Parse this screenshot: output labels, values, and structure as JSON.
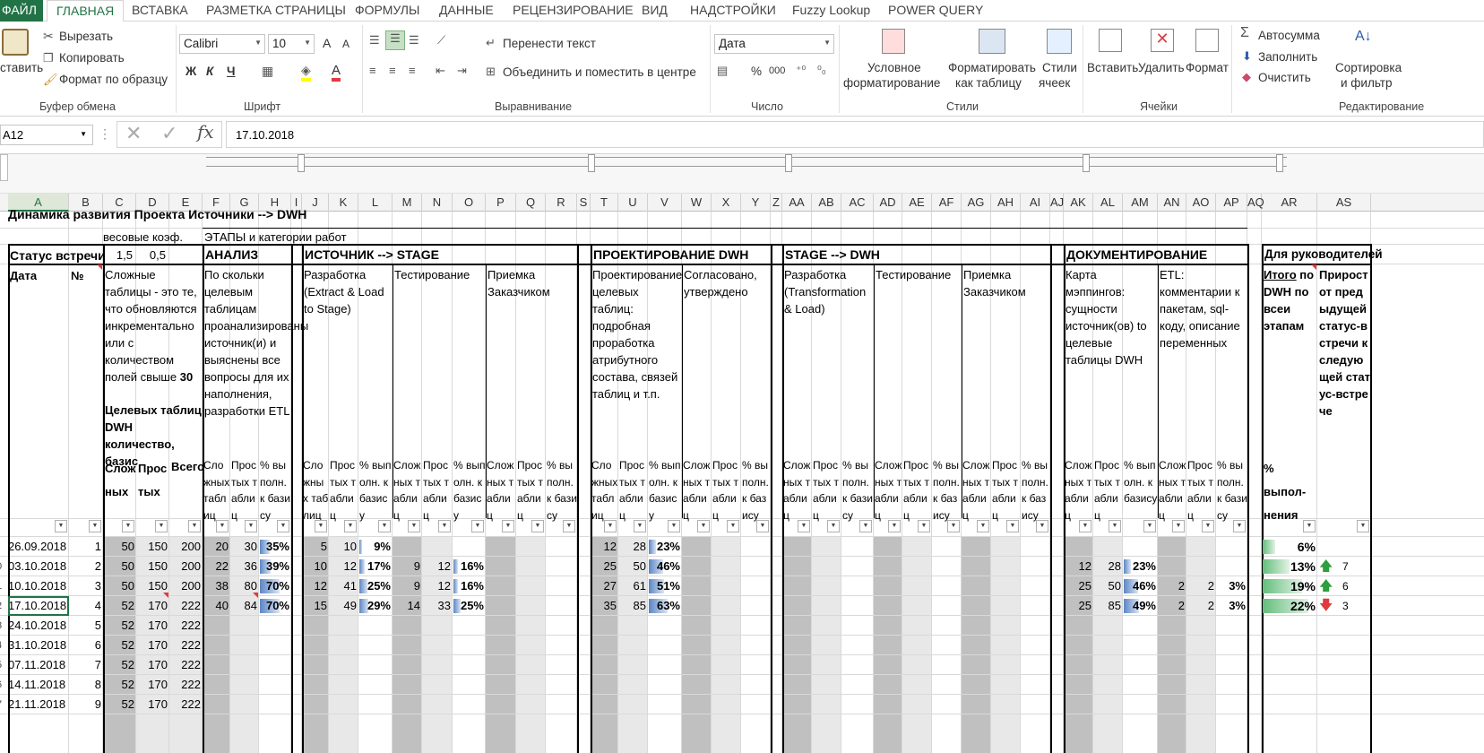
{
  "ribbon_tabs": [
    "ФАЙЛ",
    "ГЛАВНАЯ",
    "ВСТАВКА",
    "РАЗМЕТКА СТРАНИЦЫ",
    "ФОРМУЛЫ",
    "ДАННЫЕ",
    "РЕЦЕНЗИРОВАНИЕ",
    "ВИД",
    "НАДСТРОЙКИ",
    "Fuzzy Lookup",
    "POWER QUERY"
  ],
  "clipboard": {
    "paste": "ставить",
    "cut": "Вырезать",
    "copy": "Копировать",
    "painter": "Формат по образцу",
    "group": "Буфер обмена"
  },
  "font": {
    "name": "Calibri",
    "size": "10",
    "bold": "Ж",
    "italic": "К",
    "underline": "Ч",
    "color_a": "А",
    "group": "Шрифт",
    "grow": "A",
    "shrink": "A"
  },
  "align": {
    "wrap": "Перенести текст",
    "merge": "Объединить и поместить в центре",
    "group": "Выравнивание"
  },
  "number": {
    "format": "Дата",
    "percent": "%",
    "thousands": "000",
    "group": "Число"
  },
  "styles": {
    "cond1": "Условное",
    "cond2": "форматирование",
    "fmt1": "Форматировать",
    "fmt2": "как таблицу",
    "cell1": "Стили",
    "cell2": "ячеек",
    "group": "Стили"
  },
  "cells": {
    "insert": "Вставить",
    "delete": "Удалить",
    "format": "Формат",
    "group": "Ячейки"
  },
  "editing": {
    "autosum": "Автосумма",
    "fill": "Заполнить",
    "clear": "Очистить",
    "sort1": "Сортировка",
    "sort2": "и фильтр",
    "group": "Редактирование"
  },
  "formula_bar": {
    "name_box": "A12",
    "fx": "fx",
    "value": "17.10.2018"
  },
  "columns": [
    "A",
    "B",
    "C",
    "D",
    "E",
    "F",
    "G",
    "H",
    "I",
    "J",
    "K",
    "L",
    "M",
    "N",
    "O",
    "P",
    "Q",
    "R",
    "S",
    "T",
    "U",
    "V",
    "W",
    "X",
    "Y",
    "Z",
    "AA",
    "AB",
    "AC",
    "AD",
    "AE",
    "AF",
    "AG",
    "AH",
    "AI",
    "AJ",
    "AK",
    "AL",
    "AM",
    "AN",
    "AO",
    "AP",
    "AQ",
    "AR",
    "AS"
  ],
  "title": "Динамика развития Проекта Источники --> DWH",
  "weights_label": "весовые коэф.",
  "weight_complex": "1,5",
  "weight_simple": "0,5",
  "stages_label": "ЭТАПЫ и категории работ",
  "status_label": "Статус встречи",
  "sections": {
    "analysis": "АНАЛИЗ",
    "source": "ИСТОЧНИК --> STAGE",
    "design": "ПРОЕКТИРОВАНИЕ DWH",
    "stage_dwh": "STAGE --> DWH",
    "docs": "ДОКУМЕНТИРОВАНИЕ",
    "managers": "Для руководителей"
  },
  "hdr": {
    "date": "Дата",
    "num": "№",
    "complex_desc": "Сложные таблицы - это те, что обновляются инкрементально или с количеством полей свыше",
    "complex_n": "30",
    "target": "Целевых таблиц DWH количество, базис",
    "analysis_desc": "По скольки целевым таблицам проанализированы источник(и) и выяснены все вопросы для их наполнения, разработки ETL",
    "dev_etl": "Разработка (Extract & Load to Stage)",
    "testing": "Тестирование",
    "acceptance": "Приемка Заказчиком",
    "design_desc": "Проектирование целевых таблиц: подробная проработка атрибутного состава, связей таблиц и т.п.",
    "approved": "Согласовано, утверждено",
    "dev_tl": "Разработка (Transformation & Load)",
    "mapping": "Карта мэппингов: сущности источник(ов) to целевые таблицы DWH",
    "etl_comments": "ETL: комментарии к пакетам, sql-коду, описание переменных",
    "total_pre": "Итого",
    "total_rest": "по DWH по всеи этапам",
    "growth": "Прирост от предыдущей статус-встречи к следующей статус-встрече",
    "complex": "Сложных",
    "simple": "Простых",
    "all": "Всего",
    "sub_complex": "Сложных таблиц",
    "sub_simple": "Простых таблиц",
    "sub_pct": "% выполн. к базису",
    "pct_done": "% выпол-нения"
  },
  "rows": [
    {
      "rn": "",
      "date": "26.09.2018",
      "n": "1",
      "c": "50",
      "s": "150",
      "t": "200",
      "an": [
        "20",
        "30",
        "35%"
      ],
      "src": [
        "5",
        "10",
        "9%",
        "",
        "",
        ""
      ],
      "des": [
        "12",
        "28",
        "23%"
      ],
      "doc": [
        "",
        "",
        "",
        "",
        "",
        ""
      ],
      "total": "6%",
      "g": "",
      "gd": ""
    },
    {
      "rn": "0",
      "date": "03.10.2018",
      "n": "2",
      "c": "50",
      "s": "150",
      "t": "200",
      "an": [
        "22",
        "36",
        "39%"
      ],
      "src": [
        "10",
        "12",
        "17%",
        "9",
        "12",
        "16%"
      ],
      "des": [
        "25",
        "50",
        "46%"
      ],
      "doc": [
        "12",
        "28",
        "23%",
        "",
        "",
        ""
      ],
      "total": "13%",
      "g": "7",
      "gd": "up"
    },
    {
      "rn": "1",
      "date": "10.10.2018",
      "n": "3",
      "c": "50",
      "s": "150",
      "t": "200",
      "an": [
        "38",
        "80",
        "70%"
      ],
      "src": [
        "12",
        "41",
        "25%",
        "9",
        "12",
        "16%"
      ],
      "des": [
        "27",
        "61",
        "51%"
      ],
      "doc": [
        "25",
        "50",
        "46%",
        "2",
        "2",
        "3%"
      ],
      "total": "19%",
      "g": "6",
      "gd": "up"
    },
    {
      "rn": "2",
      "date": "17.10.2018",
      "n": "4",
      "c": "52",
      "s": "170",
      "t": "222",
      "an": [
        "40",
        "84",
        "70%"
      ],
      "src": [
        "15",
        "49",
        "29%",
        "14",
        "33",
        "25%"
      ],
      "des": [
        "35",
        "85",
        "63%"
      ],
      "doc": [
        "25",
        "85",
        "49%",
        "2",
        "2",
        "3%"
      ],
      "total": "22%",
      "g": "3",
      "gd": "down"
    },
    {
      "rn": "3",
      "date": "24.10.2018",
      "n": "5",
      "c": "52",
      "s": "170",
      "t": "222"
    },
    {
      "rn": "4",
      "date": "31.10.2018",
      "n": "6",
      "c": "52",
      "s": "170",
      "t": "222"
    },
    {
      "rn": "5",
      "date": "07.11.2018",
      "n": "7",
      "c": "52",
      "s": "170",
      "t": "222"
    },
    {
      "rn": "6",
      "date": "14.11.2018",
      "n": "8",
      "c": "52",
      "s": "170",
      "t": "222"
    },
    {
      "rn": "7",
      "date": "21.11.2018",
      "n": "9",
      "c": "52",
      "s": "170",
      "t": "222"
    }
  ],
  "colors": {
    "excel_green": "#217346",
    "gray_cell": "#c0c0c0",
    "light_gray": "#e8e8e8",
    "bar_blue": "#5b86c5",
    "up": "#2e9e3f",
    "down": "#e0393e"
  }
}
